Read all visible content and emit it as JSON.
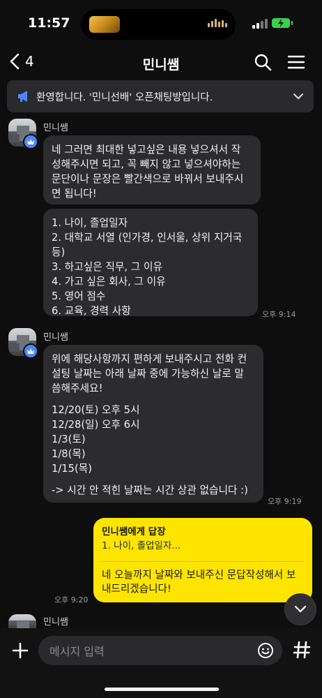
{
  "status": {
    "time": "11:57"
  },
  "header": {
    "back_count": "4",
    "title": "민니쌤"
  },
  "notice": {
    "text": "환영합니다. '민니선배' 오픈채팅방입니다."
  },
  "messages": [
    {
      "sender": "민니쌤",
      "bubble1": [
        "네 그러면 최대한 넣고싶은 내용 넣으셔서 작",
        "성해주시면 되고, 꼭 빼지 않고 넣으셔야하는",
        "문단이나 문장은 빨간색으로 바꿔서 보내주시",
        "면 됩니다!"
      ],
      "bubble2": [
        "1. 나이, 졸업일자",
        "2. 대학교 서열 (인가경, 인서울, 상위 지거국",
        "등)",
        "3. 하고싶은 직무, 그 이유",
        "4. 가고 싶은 회사, 그 이유",
        "5. 영어 점수",
        "6. 교육, 경력 사항"
      ],
      "time": "오후 9:14"
    },
    {
      "sender": "민니쌤",
      "bubble": [
        "위에 해당사항까지 편하게 보내주시고 전화 컨",
        "설팅 날짜는 아래 날짜 중에 가능하신 날로 말",
        "씀해주세요!",
        "",
        "12/20(토) 오후 5시",
        "12/28(일) 오후 6시",
        "1/3(토)",
        "1/8(목)",
        "1/15(목)",
        "",
        "-> 시간 안 적힌 날짜는 시간 상관 없습니다 :)"
      ],
      "time": "오후 9:19"
    }
  ],
  "reply": {
    "to": "민니쌤에게 답장",
    "quote": "1. 나이, 졸업일자...",
    "message": [
      "네 오늘까지 날짜와 보내주신 문답작성해서 보",
      "내드리겠습니다!"
    ],
    "time": "오후 9:20"
  },
  "next_sender": "민니쌤",
  "input": {
    "placeholder": "메시지 입력"
  },
  "colors": {
    "reply_bubble": "#fee500",
    "bubble": "#2c2c2e",
    "background": "#0e0e0e",
    "badge": "#4e86ff"
  }
}
